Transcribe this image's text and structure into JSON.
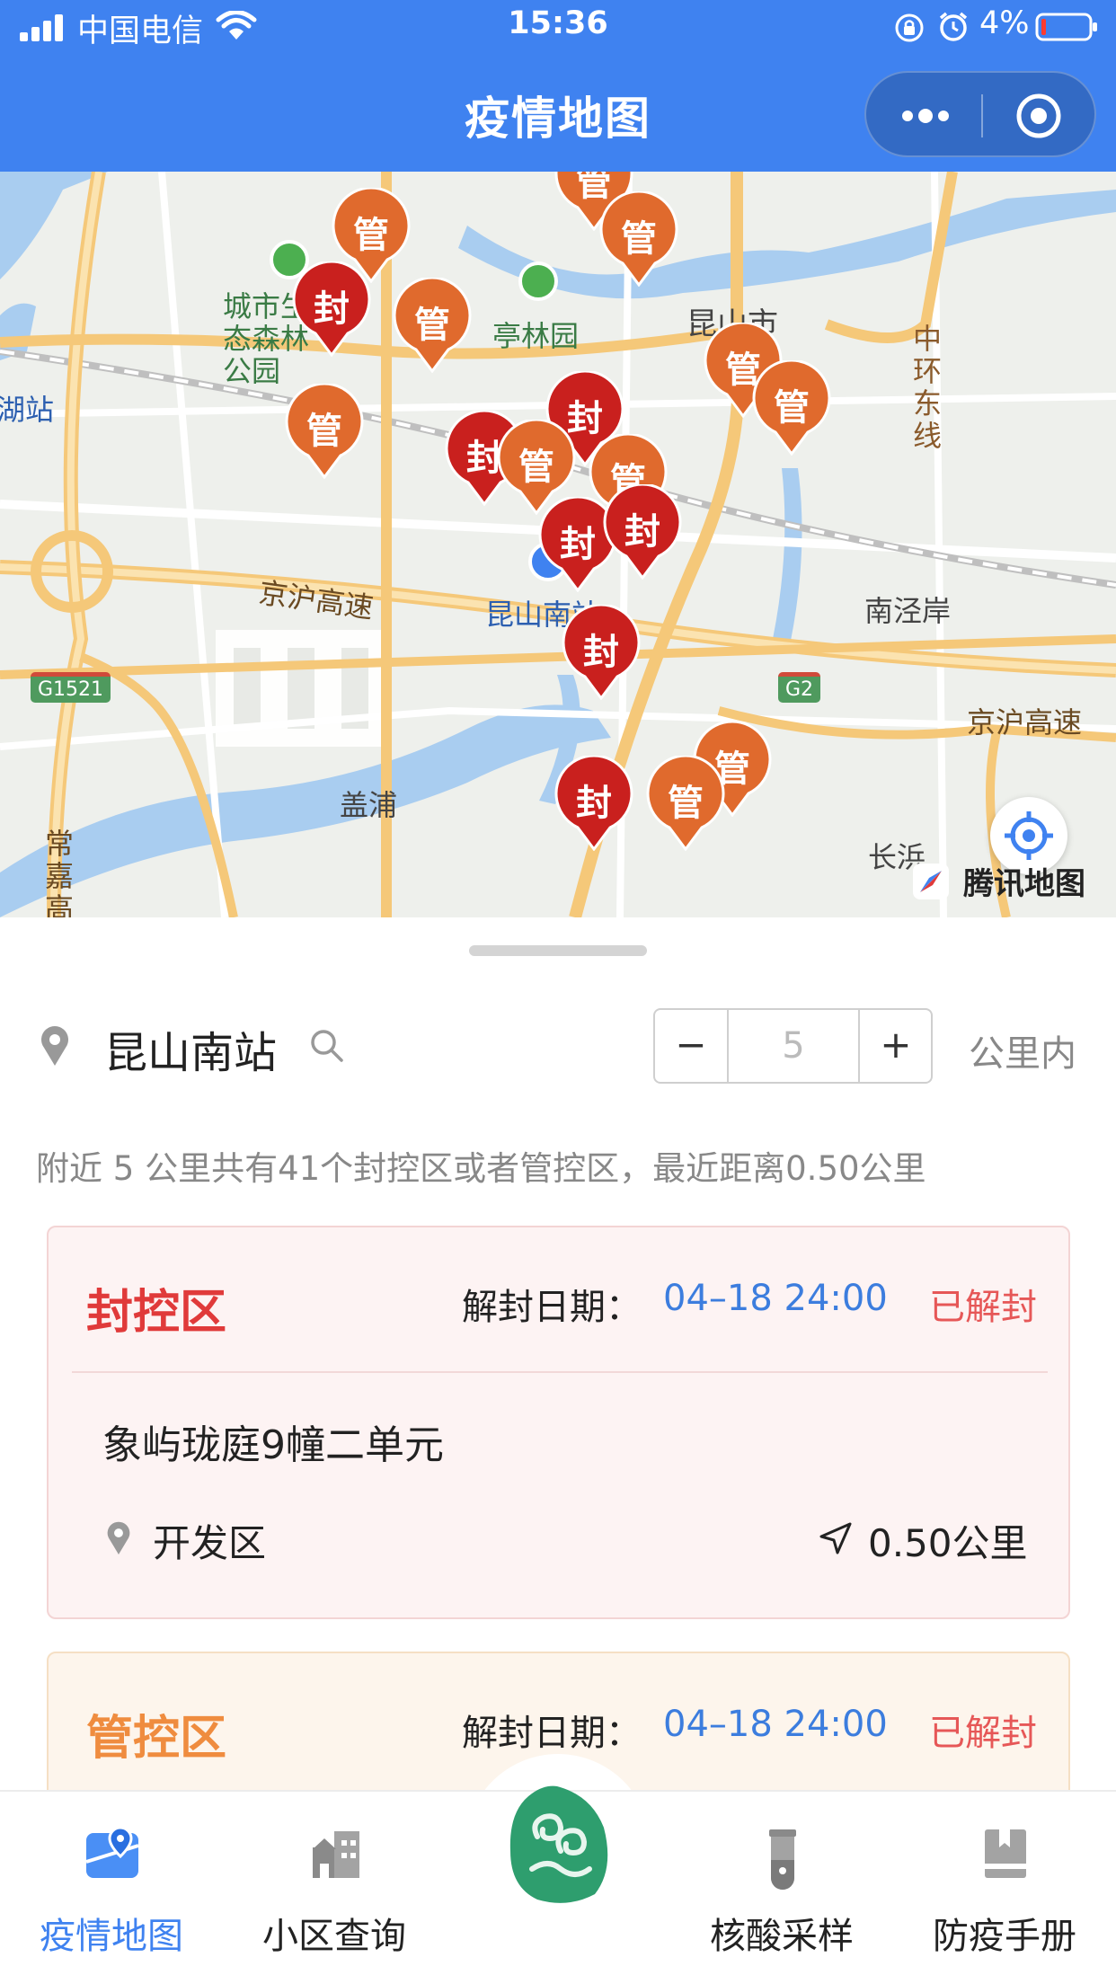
{
  "status_bar": {
    "carrier": "中国电信",
    "time": "15:36",
    "battery_pct": "4%"
  },
  "header": {
    "title": "疫情地图"
  },
  "map": {
    "labels": {
      "forest_park": "城市生态森林公园",
      "tinglin": "亭林园",
      "kunshan_city": "昆山市",
      "zhonghuan": "中环东线",
      "hu_station": "湖站",
      "jinghu_left": "京沪高速",
      "kunshan_south": "昆山南站",
      "nanjing_an": "南泾岸",
      "jinghu_right": "京沪高速",
      "g1521": "G1521",
      "g2": "G2",
      "gaipu": "盖浦",
      "changjia": "常嘉高",
      "changzhen": "长浜"
    },
    "brand": "腾讯地图",
    "markers": [
      {
        "label": "管",
        "kind": "manage"
      },
      {
        "label": "管",
        "kind": "manage"
      },
      {
        "label": "管",
        "kind": "manage"
      },
      {
        "label": "封",
        "kind": "seal"
      },
      {
        "label": "管",
        "kind": "manage"
      },
      {
        "label": "管",
        "kind": "manage"
      },
      {
        "label": "封",
        "kind": "seal"
      },
      {
        "label": "管",
        "kind": "manage"
      },
      {
        "label": "管",
        "kind": "manage"
      },
      {
        "label": "封",
        "kind": "seal"
      },
      {
        "label": "管",
        "kind": "manage"
      },
      {
        "label": "管",
        "kind": "manage"
      },
      {
        "label": "封",
        "kind": "seal"
      },
      {
        "label": "封",
        "kind": "seal"
      },
      {
        "label": "封",
        "kind": "seal"
      },
      {
        "label": "管",
        "kind": "manage"
      },
      {
        "label": "封",
        "kind": "seal"
      },
      {
        "label": "管",
        "kind": "manage"
      }
    ]
  },
  "location": {
    "name": "昆山南站",
    "radius": "5",
    "minus": "−",
    "plus": "+",
    "unit": "公里内"
  },
  "summary": "附近 5 公里共有41个封控区或者管控区，最近距离0.50公里",
  "cards": [
    {
      "type": "封控区",
      "date_label": "解封日期：",
      "date": "04–18 24:00",
      "status": "已解封",
      "name": "象屿珑庭9幢二单元",
      "district": "开发区",
      "distance": "0.50公里"
    },
    {
      "type": "管控区",
      "date_label": "解封日期：",
      "date": "04–18 24:00",
      "status": "已解封"
    }
  ],
  "tabs": [
    {
      "label": "疫情地图"
    },
    {
      "label": "小区查询"
    },
    {
      "label": "核酸采样"
    },
    {
      "label": "防疫手册"
    }
  ],
  "colors": {
    "primary": "#3f82f0",
    "seal_pin": "#c9201e",
    "manage_pin": "#e06a2d",
    "seal_text": "#e03a3a",
    "manage_text": "#ef8c3f",
    "date_blue": "#3c7dde",
    "status_red": "#e65757"
  },
  "icons": [
    "signal-icon",
    "wifi-icon",
    "lock-rotation-icon",
    "alarm-icon",
    "battery-icon",
    "more-dots-icon",
    "close-target-icon",
    "location-pin-icon",
    "search-icon",
    "navigation-arrow-icon",
    "map-tab-icon",
    "building-tab-icon",
    "test-tube-tab-icon",
    "book-tab-icon",
    "locate-icon",
    "compass-icon"
  ]
}
